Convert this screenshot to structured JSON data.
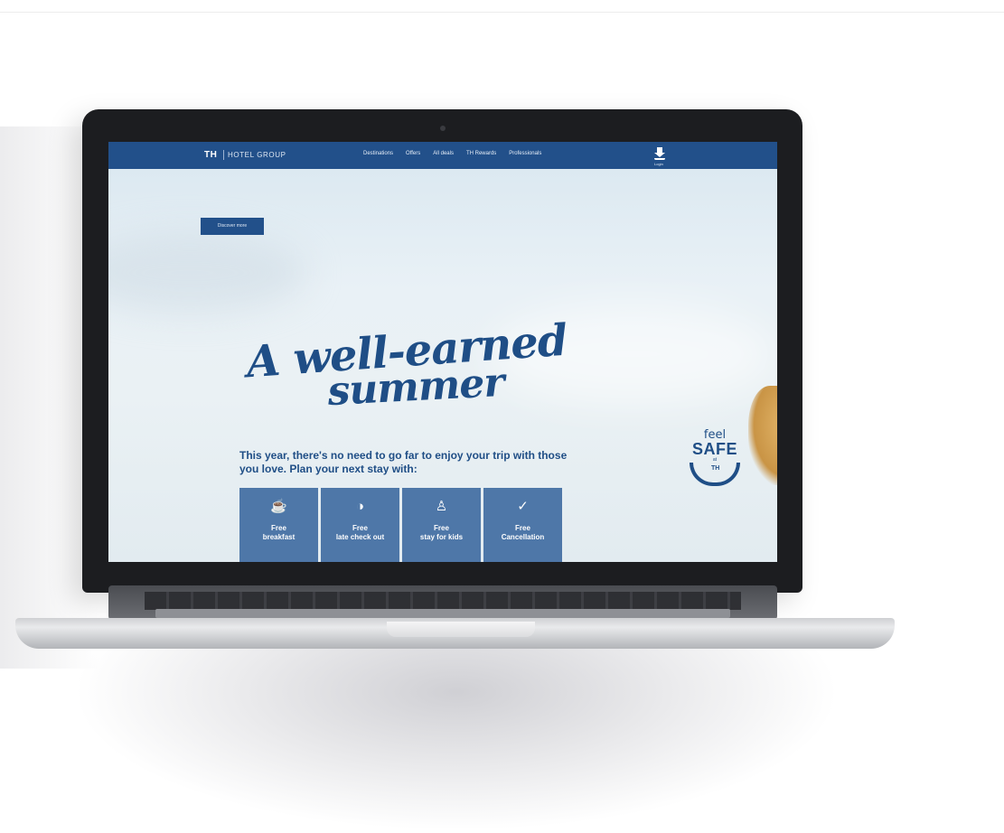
{
  "site": {
    "logo": "TH",
    "logo_sub": "HOTEL GROUP",
    "nav": [
      "Destinations",
      "Offers",
      "All deals",
      "TH Rewards",
      "Professionals"
    ],
    "download_label": "Login",
    "discover_label": "Discover more"
  },
  "hero": {
    "headline_line1": "A well-earned",
    "headline_line2": "summer",
    "intro": "This year, there's no need to go far to enjoy your trip with those you love. Plan your next stay with:"
  },
  "features": [
    {
      "icon": "coffee-icon",
      "glyph": "☕",
      "label_line1": "Free",
      "label_line2": "breakfast"
    },
    {
      "icon": "clock-icon",
      "glyph": "◑",
      "label_line1": "Free",
      "label_line2": "late check out"
    },
    {
      "icon": "child-icon",
      "glyph": "♙",
      "label_line1": "Free",
      "label_line2": "stay for kids"
    },
    {
      "icon": "check-circle-icon",
      "glyph": "✓",
      "label_line1": "Free",
      "label_line2": "Cancellation"
    }
  ],
  "badge": {
    "feel": "feel",
    "safe": "SAFE",
    "by": "at",
    "logo": "TH"
  },
  "colors": {
    "brand_blue": "#22508a",
    "tile_blue": "#4e77a8",
    "headline_blue": "#1f4e86"
  }
}
